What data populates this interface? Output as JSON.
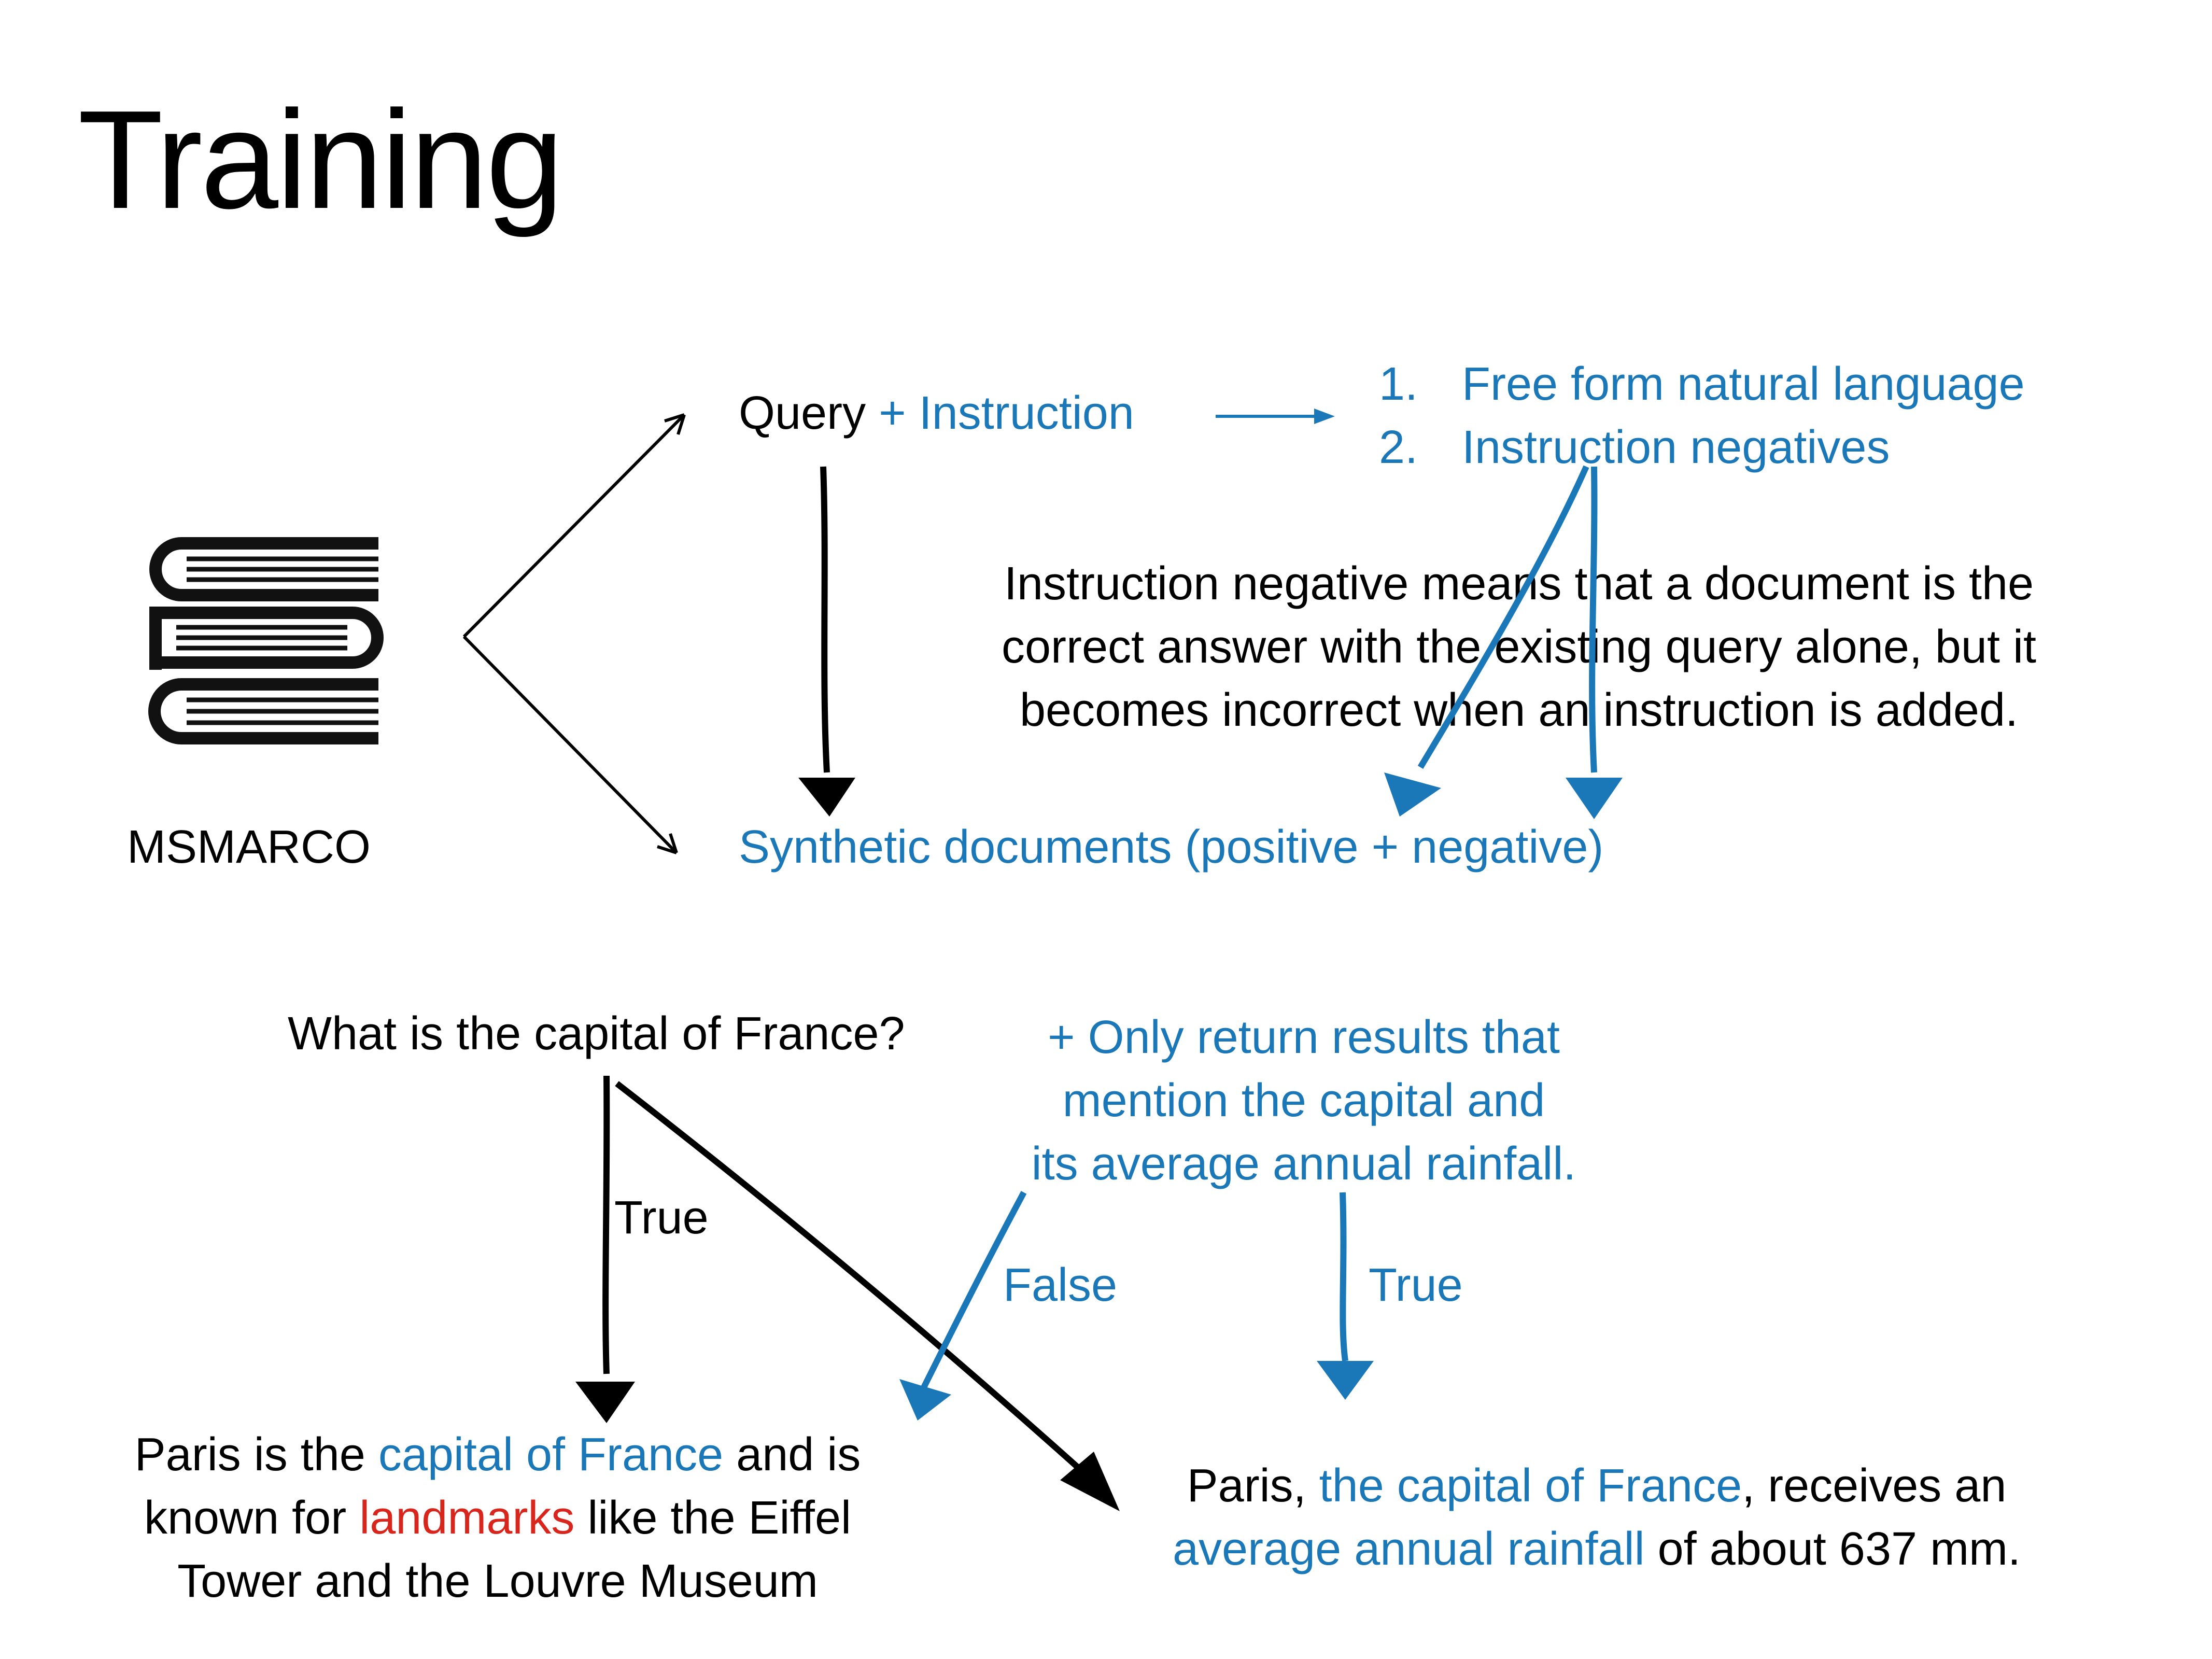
{
  "title": "Training",
  "source": {
    "label": "MSMARCO",
    "icon": "books-icon"
  },
  "query_box": {
    "query": "Query",
    "plus_instruction": " + Instruction"
  },
  "instruction_types": [
    {
      "num": "1.",
      "text": "Free form natural language"
    },
    {
      "num": "2.",
      "text": "Instruction negatives"
    }
  ],
  "definition": {
    "line1": "Instruction negative means that a document is the",
    "line2": "correct answer with the existing query alone, but it",
    "line3": "becomes incorrect when an instruction is added."
  },
  "synthetic_docs": "Synthetic documents (positive + negative)",
  "example": {
    "question": "What is the capital of France?",
    "instruction": {
      "line1": "+ Only return results that",
      "line2": "mention the capital and",
      "line3": "its average annual rainfall."
    },
    "label_true_query": "True",
    "label_false_instruction": "False",
    "label_true_instruction": "True",
    "doc_left": {
      "p1": "Paris is the ",
      "p2": "capital of France",
      "p3": " and is",
      "p4": "known for ",
      "p5": "landmarks",
      "p6": " like the Eiffel",
      "p7": "Tower and the Louvre Museum"
    },
    "doc_right": {
      "p1": "Paris, ",
      "p2": "the capital of France",
      "p3": ", receives an",
      "p4": "average annual rainfall",
      "p5": " of about 637 mm."
    }
  },
  "colors": {
    "blue": "#1a78b8",
    "red": "#d9261c",
    "black": "#000000"
  }
}
